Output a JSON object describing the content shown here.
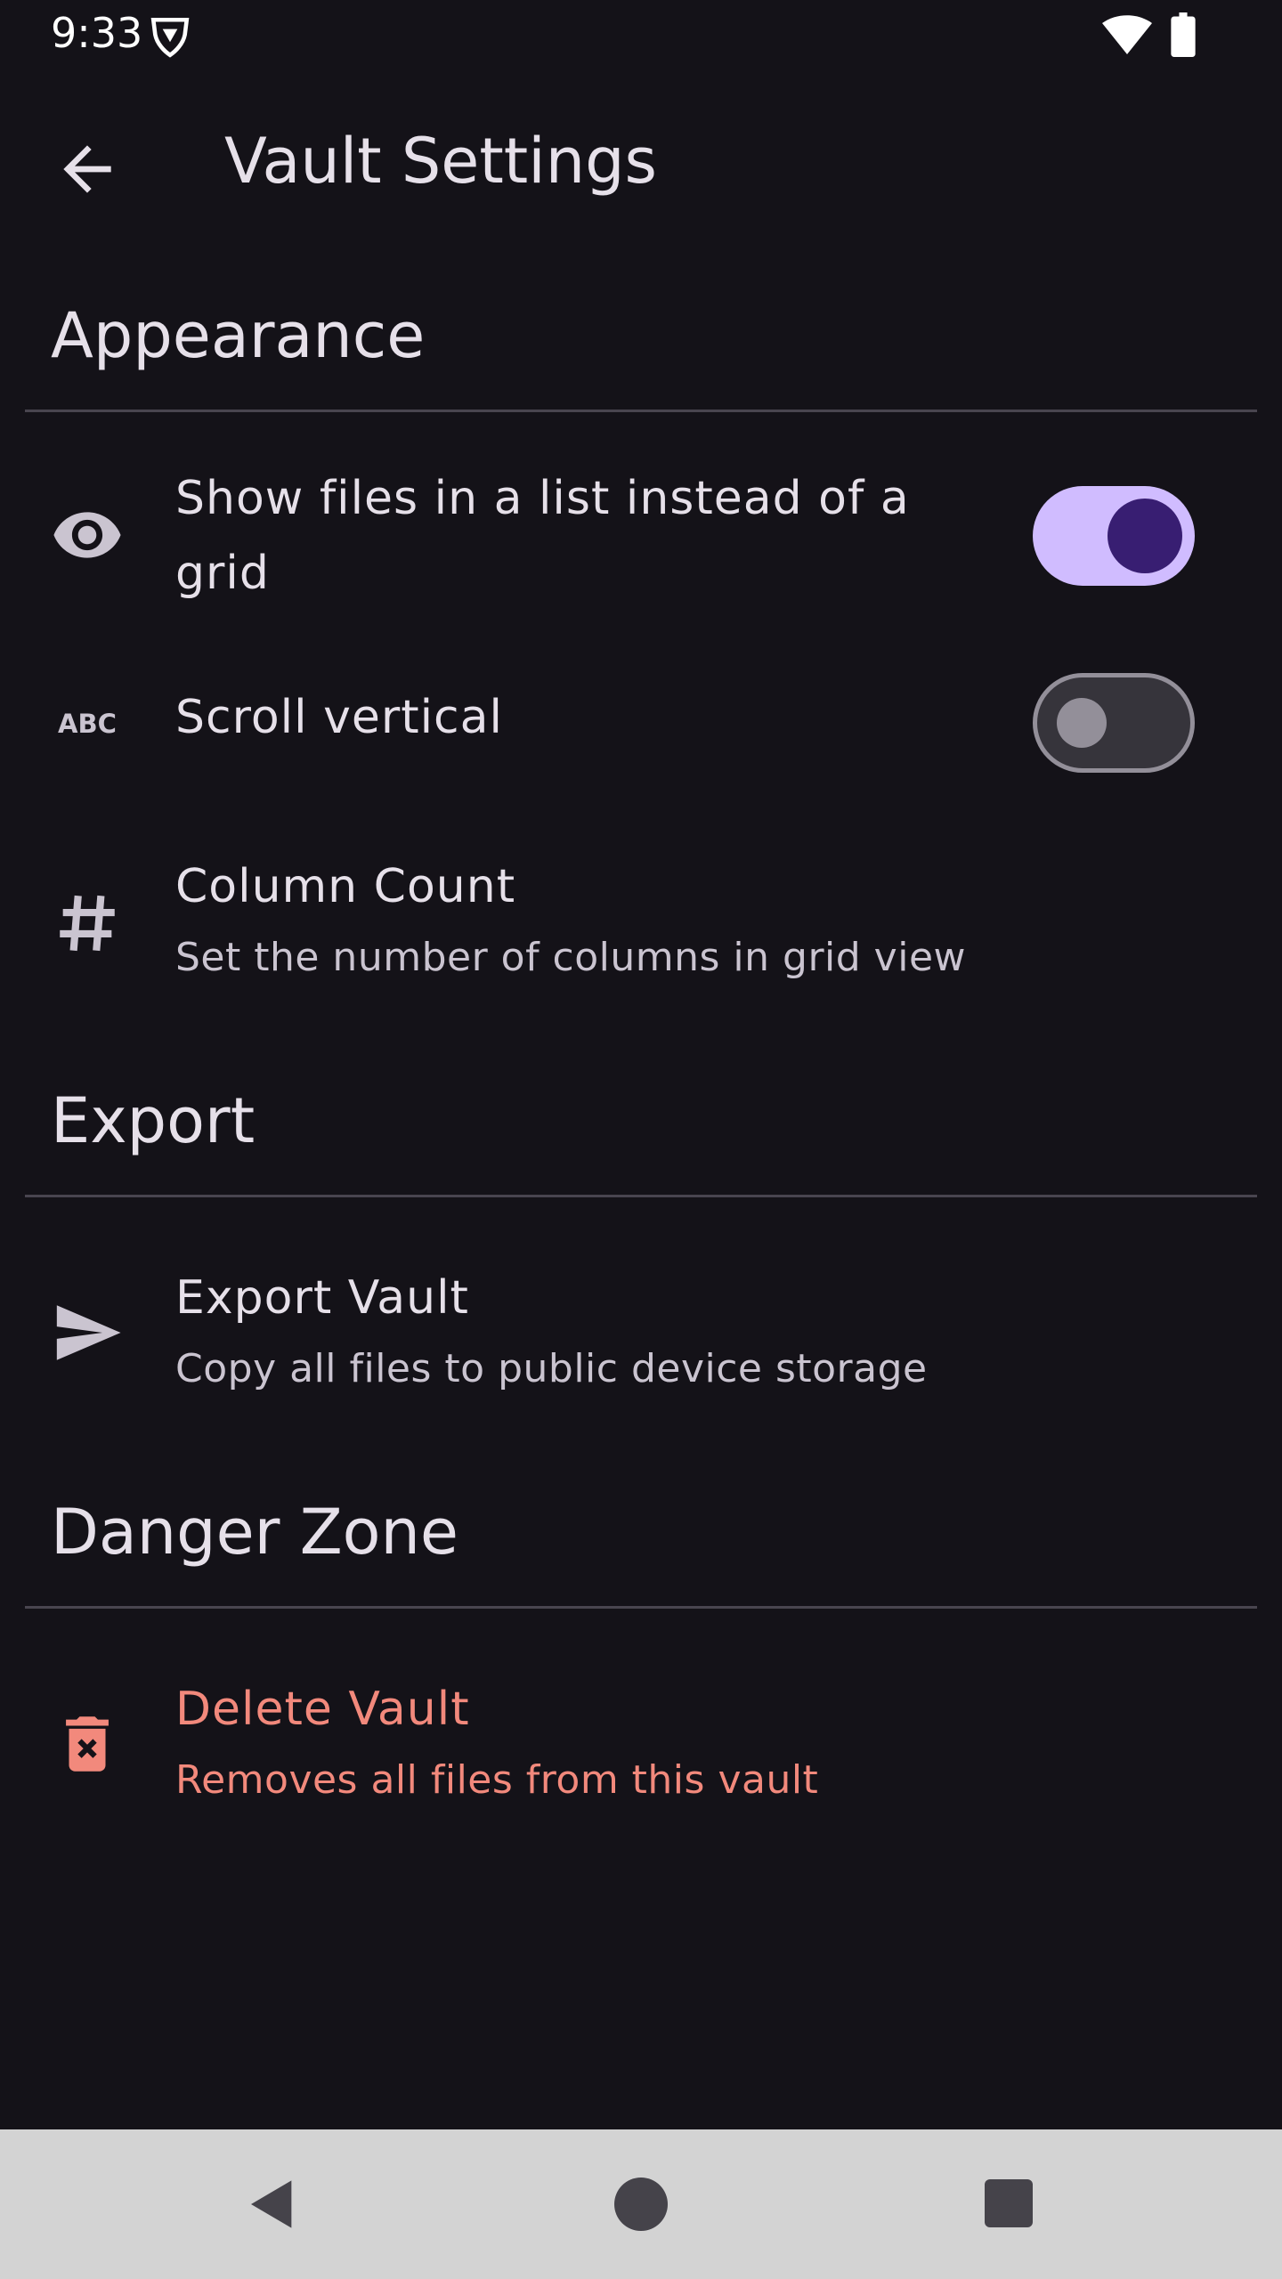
{
  "status_bar": {
    "time": "9:33",
    "icons": [
      "shield-icon",
      "wifi-icon",
      "battery-icon"
    ]
  },
  "top_bar": {
    "title": "Vault Settings",
    "back_icon": "arrow-back-icon"
  },
  "sections": {
    "appearance": {
      "header": "Appearance",
      "items": [
        {
          "icon": "eye-icon",
          "title": "Show files in a list instead of a grid",
          "toggle_on": true
        },
        {
          "icon": "abc-icon",
          "title": "Scroll vertical",
          "toggle_on": false
        },
        {
          "icon": "hash-icon",
          "title": "Column Count",
          "subtitle": "Set the number of columns in grid view"
        }
      ]
    },
    "export": {
      "header": "Export",
      "items": [
        {
          "icon": "send-icon",
          "title": "Export Vault",
          "subtitle": "Copy all files to public device storage"
        }
      ]
    },
    "danger_zone": {
      "header": "Danger Zone",
      "items": [
        {
          "icon": "delete-forever-icon",
          "title": "Delete Vault",
          "subtitle": "Removes all files from this vault"
        }
      ]
    }
  },
  "colors": {
    "background": "#141218",
    "accent": "#d0bcff",
    "accent_dark": "#381e72",
    "danger": "#f2897c",
    "divider": "#49454f",
    "nav_bar": "#d3d3d3"
  },
  "nav_bar": {
    "buttons": [
      "back-triangle-icon",
      "home-circle-icon",
      "recents-square-icon"
    ]
  }
}
